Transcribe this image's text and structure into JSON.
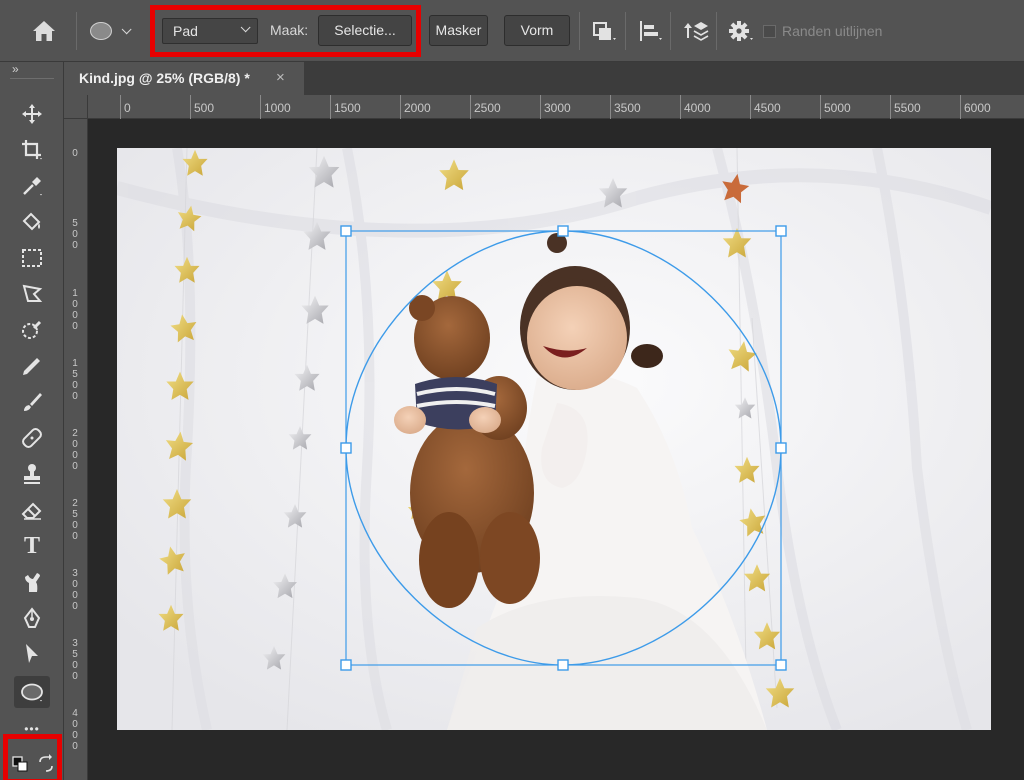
{
  "options_bar": {
    "home_icon": "home-icon",
    "shape_icon": "ellipse-icon",
    "mode_select": "Pad",
    "maak_label": "Maak:",
    "selectie_button": "Selectie...",
    "masker_button": "Masker",
    "vorm_button": "Vorm",
    "path_operations_icon": "path-operations-icon",
    "path_alignment_icon": "path-alignment-icon",
    "path_arrangement_icon": "path-arrangement-icon",
    "settings_icon": "gear-icon",
    "align_edges_label": "Randen uitlijnen",
    "highlight_color": "#e60000"
  },
  "document": {
    "tab_title": "Kind.jpg @ 25% (RGB/8) *",
    "close_symbol": "×"
  },
  "ruler_top": {
    "ticks": [
      "0",
      "500",
      "1000",
      "1500",
      "2000",
      "2500",
      "3000",
      "3500",
      "4000",
      "4500",
      "5000",
      "5500",
      "6000"
    ]
  },
  "ruler_left": {
    "ticks": [
      "0",
      "500",
      "1000",
      "1500",
      "2000",
      "2500",
      "3000",
      "3500",
      "4000"
    ]
  },
  "toolbar": {
    "collapse_label": "»",
    "tools": [
      "move-tool-icon",
      "crop-tool-icon",
      "eyedropper-tool-icon",
      "paint-bucket-tool-icon",
      "rectangular-marquee-tool-icon",
      "polygonal-lasso-tool-icon",
      "quick-selection-tool-icon",
      "pen-pencil-tool-icon",
      "brush-tool-icon",
      "healing-brush-tool-icon",
      "clone-stamp-tool-icon",
      "eraser-tool-icon",
      "type-tool-icon",
      "smudge-tool-icon",
      "pen-tool-icon",
      "path-selection-tool-icon",
      "ellipse-tool-icon",
      "more-tools-icon"
    ],
    "active_tool": "ellipse-tool-icon",
    "type_tool_glyph": "T",
    "more_tools_glyph": "•••"
  },
  "path_color": "#3d9be9"
}
